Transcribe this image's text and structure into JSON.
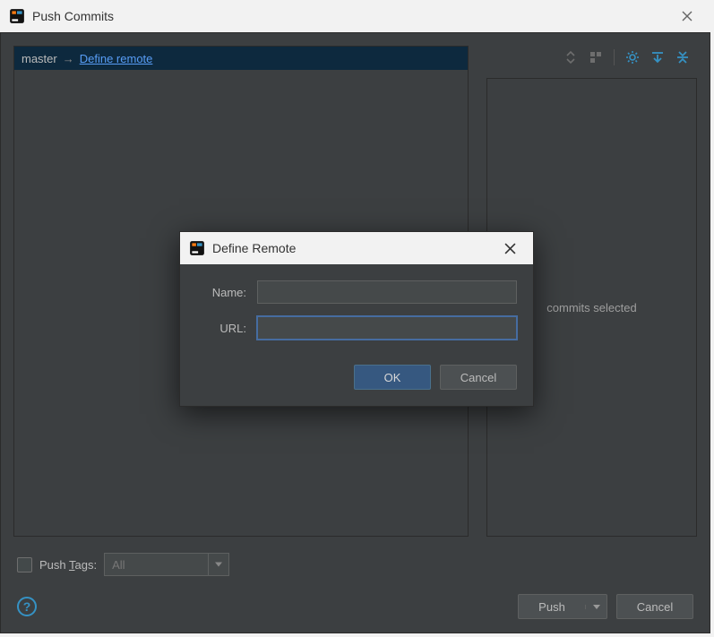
{
  "window": {
    "title": "Push Commits"
  },
  "branch": {
    "local": "master",
    "arrow": "→",
    "define_remote_label": "Define remote"
  },
  "details": {
    "placeholder_prefix": "",
    "placeholder_suffix": "commits selected"
  },
  "push_tags": {
    "label_pre": "Push ",
    "label_mn": "T",
    "label_post": "ags:",
    "selected": "All"
  },
  "buttons": {
    "push": "Push",
    "cancel": "Cancel",
    "ok": "OK",
    "help": "?"
  },
  "modal": {
    "title": "Define Remote",
    "name_label": "Name:",
    "url_label": "URL:",
    "name_value": "",
    "url_value": ""
  }
}
